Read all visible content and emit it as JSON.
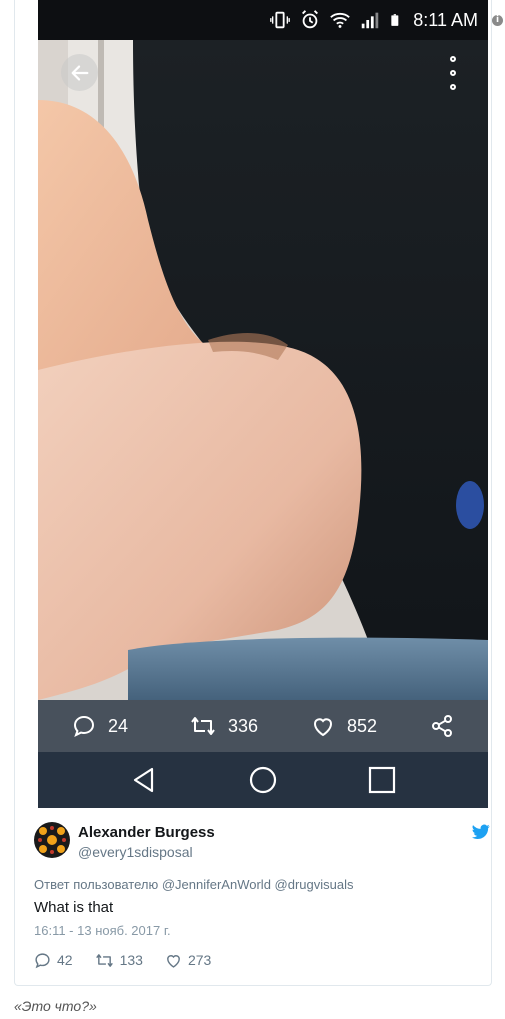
{
  "status_bar": {
    "time": "8:11 AM"
  },
  "photo_actions": {
    "replies": "24",
    "retweets": "336",
    "likes": "852"
  },
  "tweet": {
    "author_name": "Alexander Burgess",
    "author_handle": "@every1sdisposal",
    "reply_prefix": "Ответ пользователю",
    "reply_mentions": [
      "@JenniferAnWorld",
      "@drugvisuals"
    ],
    "text": "What is that",
    "datetime": "16:11 - 13 нояб. 2017 г.",
    "replies": "42",
    "retweets": "133",
    "likes": "273"
  },
  "caption": "«Это что?»",
  "colors": {
    "twitter_blue": "#1da1f2",
    "nav_bar": "#263241",
    "status_bar": "#0d0f12"
  }
}
